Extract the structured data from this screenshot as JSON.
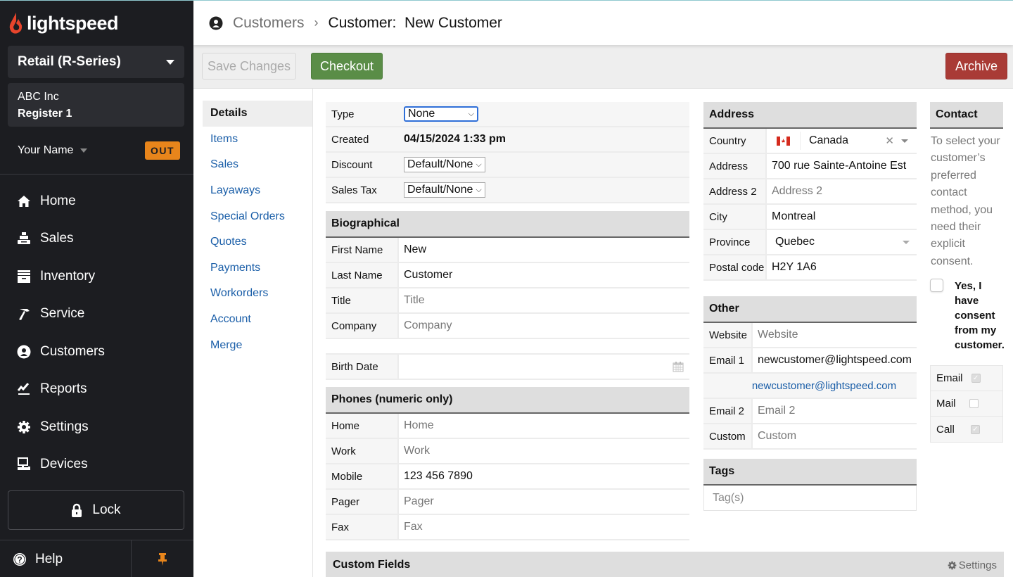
{
  "brand": {
    "name": "lightspeed",
    "accent": "#e8452c"
  },
  "sidebar": {
    "product_selector": "Retail (R-Series)",
    "store_name": "ABC Inc",
    "register": "Register 1",
    "user_name": "Your Name",
    "clock_status": "OUT",
    "nav_items": [
      {
        "label": "Home",
        "icon": "home-icon"
      },
      {
        "label": "Sales",
        "icon": "cash-register-icon"
      },
      {
        "label": "Inventory",
        "icon": "inventory-box-icon"
      },
      {
        "label": "Service",
        "icon": "hammer-icon"
      },
      {
        "label": "Customers",
        "icon": "customer-icon"
      },
      {
        "label": "Reports",
        "icon": "reports-icon"
      },
      {
        "label": "Settings",
        "icon": "gear-icon"
      },
      {
        "label": "Devices",
        "icon": "devices-icon"
      }
    ],
    "lock_label": "Lock",
    "help_label": "Help"
  },
  "header": {
    "breadcrumb_root": "Customers",
    "breadcrumb_current": "Customer:  New Customer"
  },
  "toolbar": {
    "save_label": "Save Changes",
    "checkout_label": "Checkout",
    "archive_label": "Archive"
  },
  "subnav": {
    "items": [
      "Details",
      "Items",
      "Sales",
      "Layaways",
      "Special Orders",
      "Quotes",
      "Payments",
      "Workorders",
      "Account",
      "Merge"
    ],
    "active": "Details"
  },
  "general": {
    "type_label": "Type",
    "type_value": "None",
    "created_label": "Created",
    "created_value": "04/15/2024 1:33 pm",
    "discount_label": "Discount",
    "discount_value": "Default/None",
    "sales_tax_label": "Sales Tax",
    "sales_tax_value": "Default/None"
  },
  "biographical": {
    "title": "Biographical",
    "first_name_label": "First Name",
    "first_name_value": "New",
    "last_name_label": "Last Name",
    "last_name_value": "Customer",
    "title_label": "Title",
    "title_placeholder": "Title",
    "company_label": "Company",
    "company_placeholder": "Company",
    "birth_date_label": "Birth Date"
  },
  "phones": {
    "title": "Phones (numeric only)",
    "home_label": "Home",
    "home_placeholder": "Home",
    "work_label": "Work",
    "work_placeholder": "Work",
    "mobile_label": "Mobile",
    "mobile_value": "123 456 7890",
    "pager_label": "Pager",
    "pager_placeholder": "Pager",
    "fax_label": "Fax",
    "fax_placeholder": "Fax"
  },
  "address": {
    "title": "Address",
    "country_label": "Country",
    "country_value": "Canada",
    "address_label": "Address",
    "address_value": "700 rue Sainte-Antoine Est",
    "address2_label": "Address 2",
    "address2_placeholder": "Address 2",
    "city_label": "City",
    "city_value": "Montreal",
    "province_label": "Province",
    "province_value": "Quebec",
    "postal_label": "Postal code",
    "postal_value": "H2Y 1A6"
  },
  "other": {
    "title": "Other",
    "website_label": "Website",
    "website_placeholder": "Website",
    "email1_label": "Email 1",
    "email1_value": "newcustomer@lightspeed.com",
    "email1_link": "newcustomer@lightspeed.com",
    "email2_label": "Email 2",
    "email2_placeholder": "Email 2",
    "custom_label": "Custom",
    "custom_placeholder": "Custom"
  },
  "tags": {
    "title": "Tags",
    "placeholder": "Tag(s)"
  },
  "contact": {
    "title": "Contact",
    "description": "To select your customer’s preferred contact method, you need their explicit consent.",
    "consent_label": "Yes, I have consent from my customer.",
    "consent_checked": false,
    "methods": [
      {
        "label": "Email",
        "checked": true
      },
      {
        "label": "Mail",
        "checked": false
      },
      {
        "label": "Call",
        "checked": true
      }
    ]
  },
  "custom_fields": {
    "title": "Custom Fields",
    "settings_label": "Settings"
  }
}
